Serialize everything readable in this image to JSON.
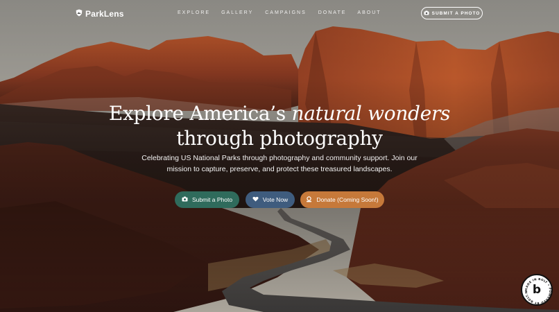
{
  "brand": {
    "name": "ParkLens"
  },
  "nav": {
    "items": [
      "EXPLORE",
      "GALLERY",
      "CAMPAIGNS",
      "DONATE",
      "ABOUT"
    ]
  },
  "header": {
    "submit_label": "SUBMIT A PHOTO"
  },
  "hero": {
    "title_line1_prefix": "Explore America’s ",
    "title_line1_italic": "natural wonders",
    "title_line2": "through photography",
    "subtitle": "Celebrating US National Parks through photography and community support. Join our mission to capture, preserve, and protect these treasured landscapes."
  },
  "cta": {
    "submit": "Submit a Photo",
    "vote": "Vote Now",
    "donate": "Donate (Coming Soon!)"
  },
  "colors": {
    "submit": "#2f6b5c",
    "vote": "#3f5c7e",
    "donate": "#c6793a"
  },
  "icons": {
    "logo": "shield-icon",
    "submit": "camera-icon",
    "vote": "heart-icon",
    "donate": "donate-icon"
  },
  "badge": {
    "letter": "b",
    "ring_text": "MADE IN BOLT • POWERED BY BOLT.NEW • "
  }
}
